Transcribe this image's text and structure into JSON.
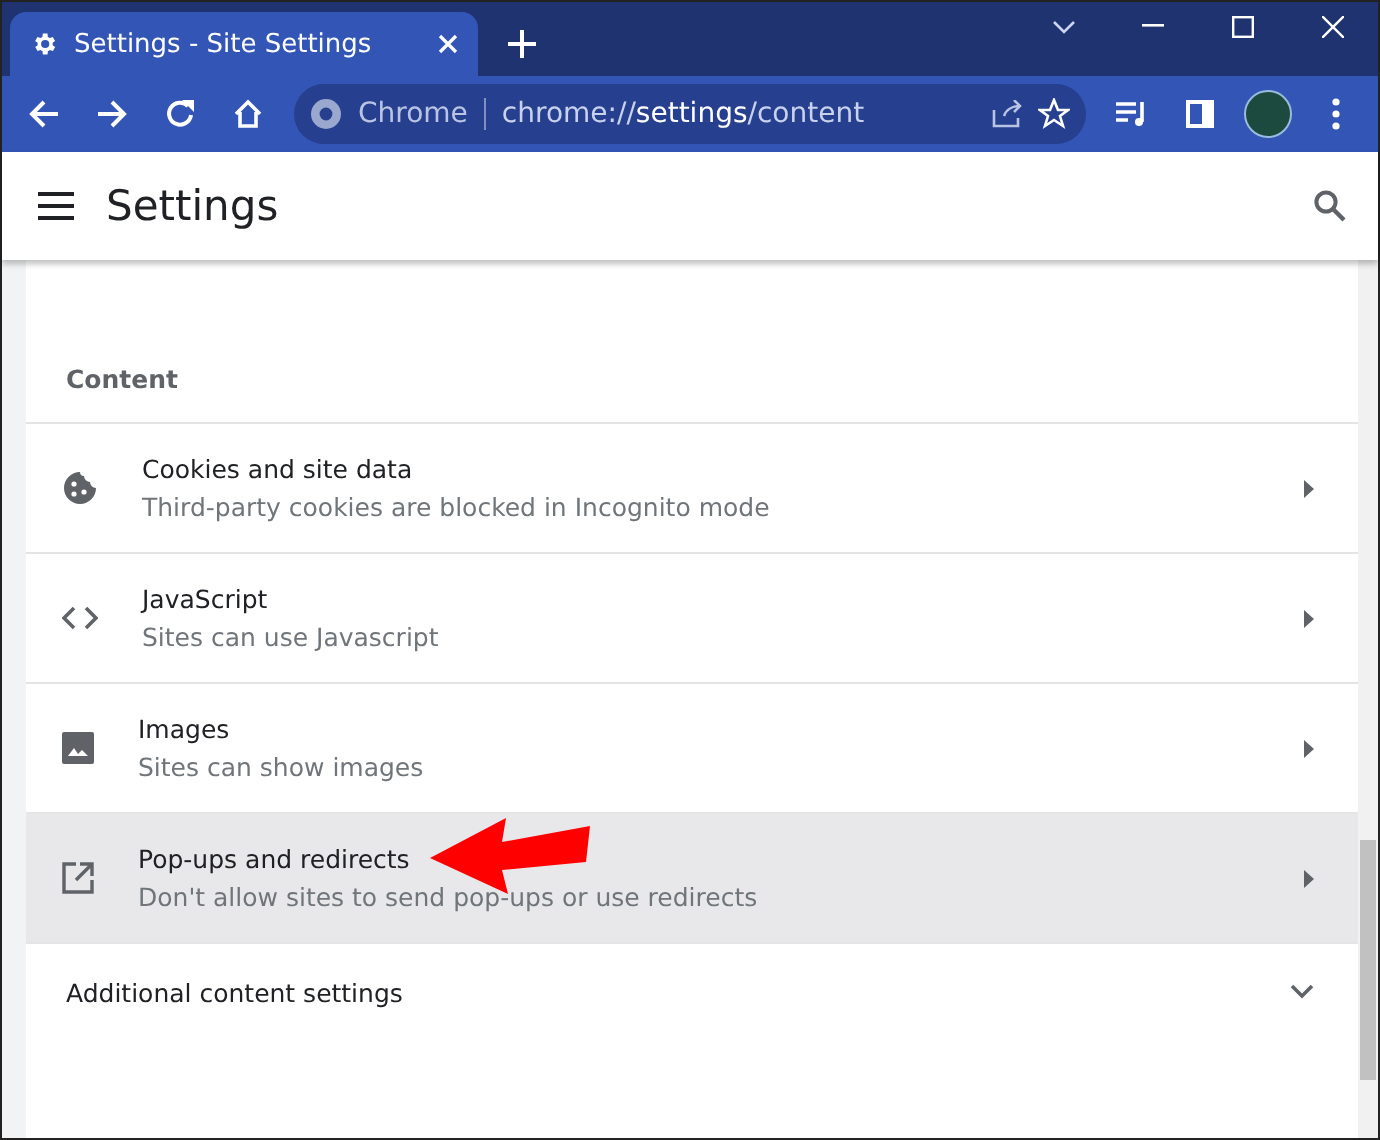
{
  "window": {
    "tab_title": "Settings - Site Settings"
  },
  "toolbar": {
    "omnibox_label": "Chrome",
    "url": "chrome://**settings**/content"
  },
  "header": {
    "title": "Settings"
  },
  "section": {
    "heading": "Content"
  },
  "rows": [
    {
      "kind": "cookie",
      "title": "Cookies and site data",
      "subtitle": "Third-party cookies are blocked in Incognito mode",
      "selected": false
    },
    {
      "kind": "code",
      "title": "JavaScript",
      "subtitle": "Sites can use Javascript",
      "selected": false
    },
    {
      "kind": "image",
      "title": "Images",
      "subtitle": "Sites can show images",
      "selected": false
    },
    {
      "kind": "popup",
      "title": "Pop-ups and redirects",
      "subtitle": "Don't allow sites to send pop-ups or use redirects",
      "selected": true,
      "annotated": true
    }
  ],
  "expander": {
    "label": "Additional content settings",
    "expanded": false
  }
}
